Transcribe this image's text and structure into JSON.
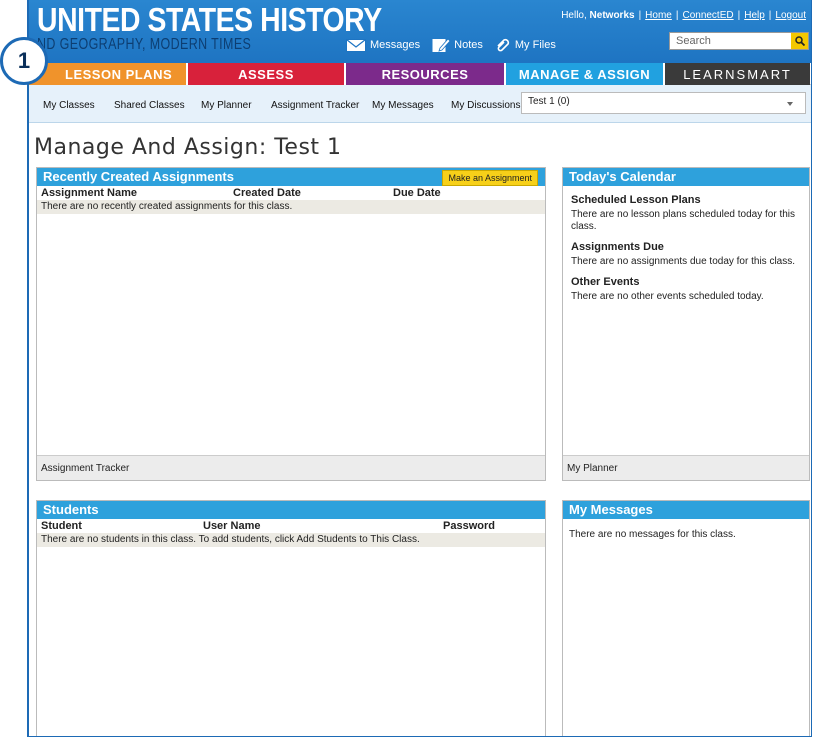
{
  "header": {
    "title": "UNITED STATES HISTORY",
    "subtitle": "ND GEOGRAPHY, MODERN TIMES",
    "greeting_prefix": "Hello, ",
    "greeting_user": "Networks",
    "links": [
      "Home",
      "ConnectED",
      "Help",
      "Logout"
    ],
    "tools": [
      {
        "label": "Messages",
        "icon": "envelope-icon"
      },
      {
        "label": "Notes",
        "icon": "notes-icon"
      },
      {
        "label": "My Files",
        "icon": "paperclip-icon"
      }
    ],
    "search_placeholder": "Search"
  },
  "callout_number": "1",
  "tabs": [
    "LESSON PLANS",
    "ASSESS",
    "RESOURCES",
    "MANAGE & ASSIGN",
    "LEARNSMART"
  ],
  "subnav": {
    "items": [
      "My Classes",
      "Shared Classes",
      "My Planner",
      "Assignment Tracker",
      "My Messages",
      "My Discussions"
    ],
    "class_select": "Test 1 (0)"
  },
  "page_title": "Manage And Assign: Test 1",
  "assignments": {
    "title": "Recently Created Assignments",
    "button": "Make an Assignment",
    "columns": [
      "Assignment Name",
      "Created Date",
      "Due Date"
    ],
    "empty": "There are no recently created assignments for this class.",
    "footer": "Assignment Tracker"
  },
  "calendar": {
    "title": "Today's Calendar",
    "sections": [
      {
        "heading": "Scheduled Lesson Plans",
        "text": "There are no lesson plans scheduled today for this class."
      },
      {
        "heading": "Assignments Due",
        "text": "There are no assignments due today for this class."
      },
      {
        "heading": "Other Events",
        "text": "There are no other events scheduled today."
      }
    ],
    "footer": "My Planner"
  },
  "students": {
    "title": "Students",
    "columns": [
      "Student",
      "User Name",
      "Password"
    ],
    "empty": "There are no students in this class. To add students, click Add Students to This Class."
  },
  "messages": {
    "title": "My Messages",
    "empty": "There are no messages for this class."
  },
  "colors": {
    "header_blue": "#1e74c2",
    "lesson_plans": "#f0932b",
    "assess": "#d8213b",
    "resources": "#7c2a8b",
    "manage_assign": "#21a1e0",
    "learnsmart": "#3a3a3a",
    "panel_title": "#2ea1dc",
    "button_yellow": "#f7d019"
  }
}
